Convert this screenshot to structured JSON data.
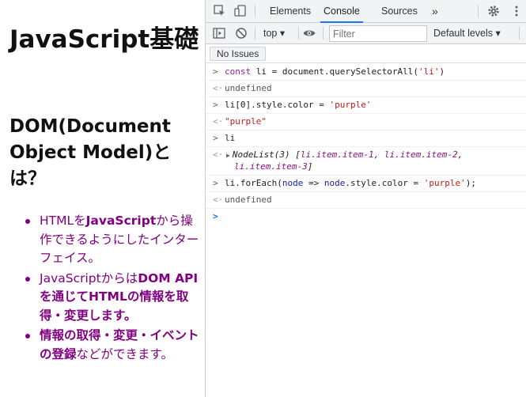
{
  "page": {
    "title": "JavaScript基礎",
    "heading": "DOM(Document Object Model)とは？",
    "list": [
      {
        "plain_a": "HTMLを",
        "bold": "JavaScript",
        "plain_b": "から操作できるようにしたインターフェイス。"
      },
      {
        "plain_a": "JavaScriptからは",
        "bold": "DOM APIを通じてHTMLの情報を取得・変更します。",
        "plain_b": ""
      },
      {
        "plain_a": "",
        "bold": "情報の取得・変更・イベントの登録",
        "plain_b": "などができます。"
      }
    ]
  },
  "devtools": {
    "tabs": [
      "Elements",
      "Console",
      "Sources"
    ],
    "active_tab": "Console",
    "more_tabs": "»",
    "icons": {
      "inspect": "inspect-element-icon",
      "device": "device-toolbar-icon",
      "settings": "gear-icon",
      "menu": "kebab-menu-icon",
      "sidebar": "console-sidebar-icon",
      "clear": "clear-console-icon",
      "eye": "live-expression-icon"
    },
    "context": "top ▾",
    "filter_placeholder": "Filter",
    "levels": "Default levels ▾",
    "issues_button": "No Issues",
    "accent_color": "#1a73e8",
    "console": {
      "cmd1": {
        "kw": "const",
        "rest_a": " li = document.querySelectorAll(",
        "str": "'li'",
        "rest_b": ")"
      },
      "out1": "undefined",
      "cmd2": {
        "pre": "li[0].style.color = ",
        "str": "'purple'"
      },
      "out2": "\"purple\"",
      "cmd3": "li",
      "out3": {
        "head": "NodeList(3) [",
        "item1": "li.item.item-1",
        "sep1": ", ",
        "item2": "li.item.item-2",
        "sep2": ",",
        "item3": "li.item.item-3",
        "tail": "]"
      },
      "cmd4": {
        "pre": "li.forEach(",
        "param": "node",
        "mid": " => ",
        "param2": "node",
        "post": ".style.color = ",
        "str": "'purple'",
        "end": ");"
      },
      "out4": "undefined"
    }
  }
}
